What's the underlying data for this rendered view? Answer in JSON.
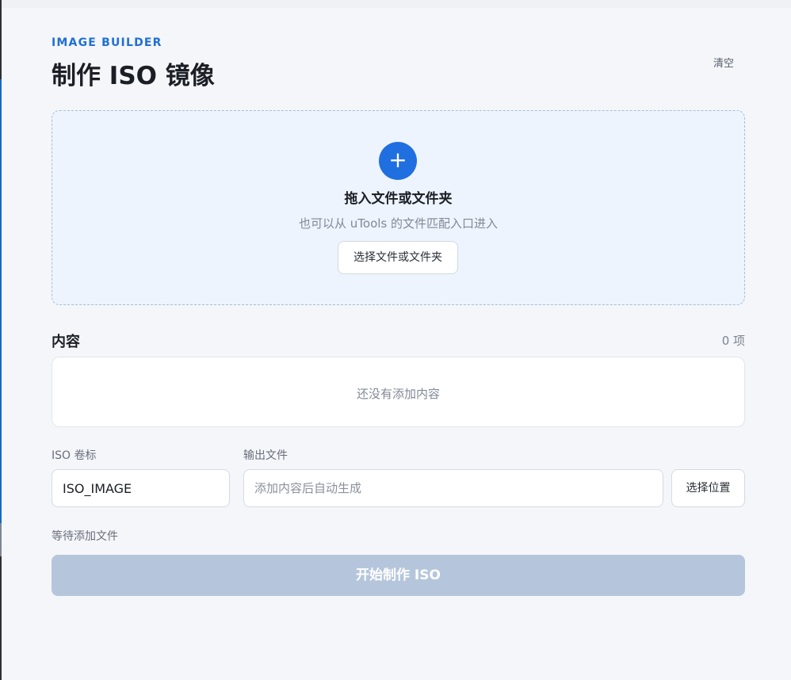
{
  "header": {
    "eyebrow": "IMAGE BUILDER",
    "title": "制作 ISO 镜像",
    "clear_label": "清空"
  },
  "dropzone": {
    "icon": "plus-icon",
    "title": "拖入文件或文件夹",
    "subtitle": "也可以从 uTools 的文件匹配入口进入",
    "button_label": "选择文件或文件夹"
  },
  "content": {
    "label": "内容",
    "count_text": "0 项",
    "empty_text": "还没有添加内容"
  },
  "volume": {
    "label": "ISO 卷标",
    "value": "ISO_IMAGE"
  },
  "output": {
    "label": "输出文件",
    "placeholder": "添加内容后自动生成",
    "button_label": "选择位置"
  },
  "status_text": "等待添加文件",
  "start_button_label": "开始制作 ISO",
  "colors": {
    "accent": "#1f6fe0",
    "dropzone_bg": "#edf4fd",
    "disabled_button": "#b5c6dc"
  }
}
